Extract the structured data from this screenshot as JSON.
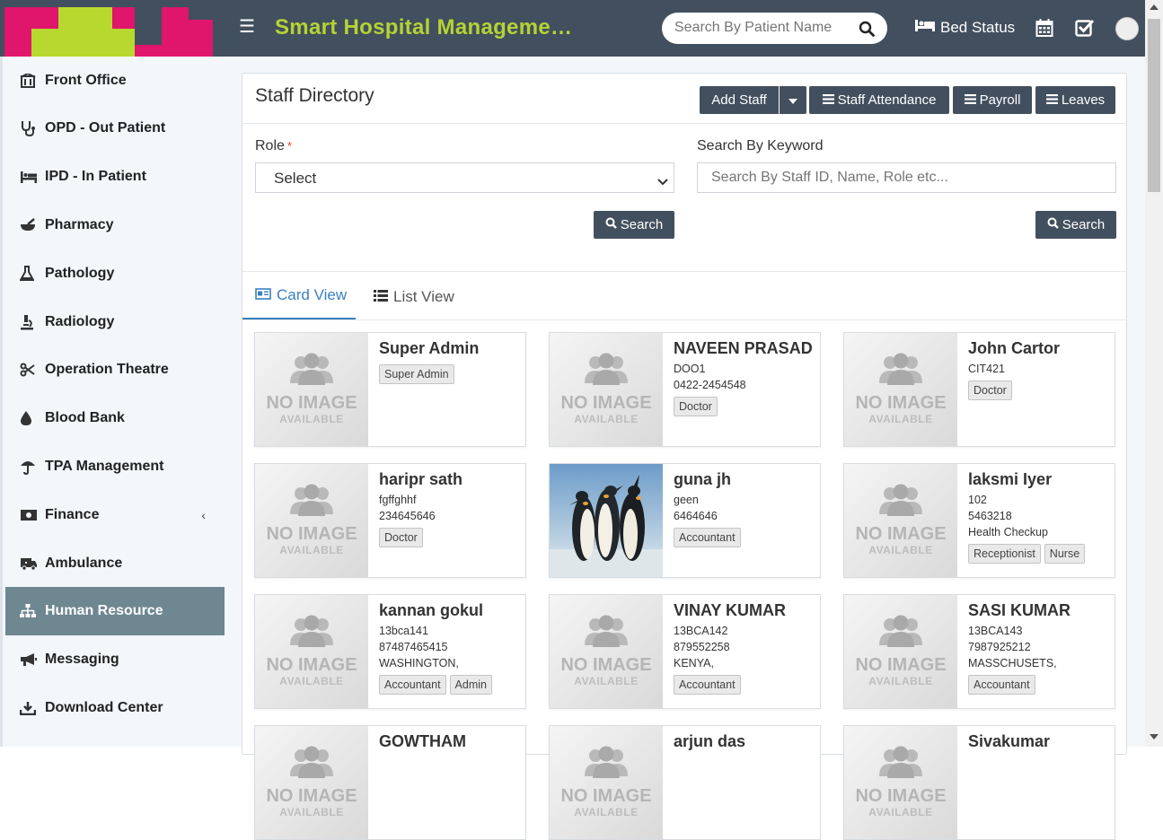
{
  "header": {
    "title": "Smart Hospital Manageme…",
    "search_placeholder": "Search By Patient Name",
    "bed_status": "Bed Status"
  },
  "sidebar": {
    "items": [
      {
        "label": "Front Office",
        "icon": "building-icon"
      },
      {
        "label": "OPD - Out Patient",
        "icon": "stethoscope-icon"
      },
      {
        "label": "IPD - In Patient",
        "icon": "bed-icon"
      },
      {
        "label": "Pharmacy",
        "icon": "mortar-pestle-icon"
      },
      {
        "label": "Pathology",
        "icon": "flask-icon"
      },
      {
        "label": "Radiology",
        "icon": "microscope-icon"
      },
      {
        "label": "Operation Theatre",
        "icon": "scissors-icon"
      },
      {
        "label": "Blood Bank",
        "icon": "droplet-icon"
      },
      {
        "label": "TPA Management",
        "icon": "umbrella-icon"
      },
      {
        "label": "Finance",
        "icon": "money-icon"
      },
      {
        "label": "Ambulance",
        "icon": "ambulance-icon"
      },
      {
        "label": "Human Resource",
        "icon": "sitemap-icon"
      },
      {
        "label": "Messaging",
        "icon": "bullhorn-icon"
      },
      {
        "label": "Download Center",
        "icon": "download-icon"
      }
    ]
  },
  "page": {
    "title": "Staff Directory",
    "add_staff": "Add Staff",
    "staff_attendance": "Staff Attendance",
    "payroll": "Payroll",
    "leaves": "Leaves",
    "role_label": "Role",
    "role_required": "*",
    "role_value": "Select",
    "keyword_label": "Search By Keyword",
    "keyword_placeholder": "Search By Staff ID, Name, Role etc...",
    "search_button": "Search",
    "tab_card": "Card View",
    "tab_list": "List View"
  },
  "no_image": {
    "line1": "NO IMAGE",
    "line2": "AVAILABLE"
  },
  "staff": [
    {
      "name": "Super Admin",
      "info": [],
      "tags": [
        "Super Admin"
      ],
      "photo": "none"
    },
    {
      "name": "NAVEEN PRASAD",
      "info": [
        "DOO1",
        "0422-2454548"
      ],
      "tags": [
        "Doctor"
      ],
      "photo": "none"
    },
    {
      "name": "John Cartor",
      "info": [
        "CIT421"
      ],
      "tags": [
        "Doctor"
      ],
      "photo": "none"
    },
    {
      "name": "haripr sath",
      "info": [
        "fgffghhf",
        "234645646"
      ],
      "tags": [
        "Doctor"
      ],
      "photo": "none"
    },
    {
      "name": "guna jh",
      "info": [
        "geen",
        "6464646"
      ],
      "tags": [
        "Accountant"
      ],
      "photo": "penguins"
    },
    {
      "name": "laksmi Iyer",
      "info": [
        "102",
        "5463218",
        "Health Checkup"
      ],
      "tags": [
        "Receptionist",
        "Nurse"
      ],
      "photo": "none"
    },
    {
      "name": "kannan gokul",
      "info": [
        "13bca141",
        "87487465415",
        "WASHINGTON,"
      ],
      "tags": [
        "Accountant",
        "Admin"
      ],
      "photo": "none"
    },
    {
      "name": "VINAY KUMAR",
      "info": [
        "13BCA142",
        "879552258",
        "KENYA,"
      ],
      "tags": [
        "Accountant"
      ],
      "photo": "none"
    },
    {
      "name": "SASI KUMAR",
      "info": [
        "13BCA143",
        "7987925212",
        "MASSCHUSETS,"
      ],
      "tags": [
        "Accountant"
      ],
      "photo": "none"
    },
    {
      "name": "GOWTHAM",
      "info": [],
      "tags": [],
      "photo": "none"
    },
    {
      "name": "arjun das",
      "info": [],
      "tags": [],
      "photo": "none"
    },
    {
      "name": "Sivakumar",
      "info": [],
      "tags": [],
      "photo": "none"
    }
  ]
}
